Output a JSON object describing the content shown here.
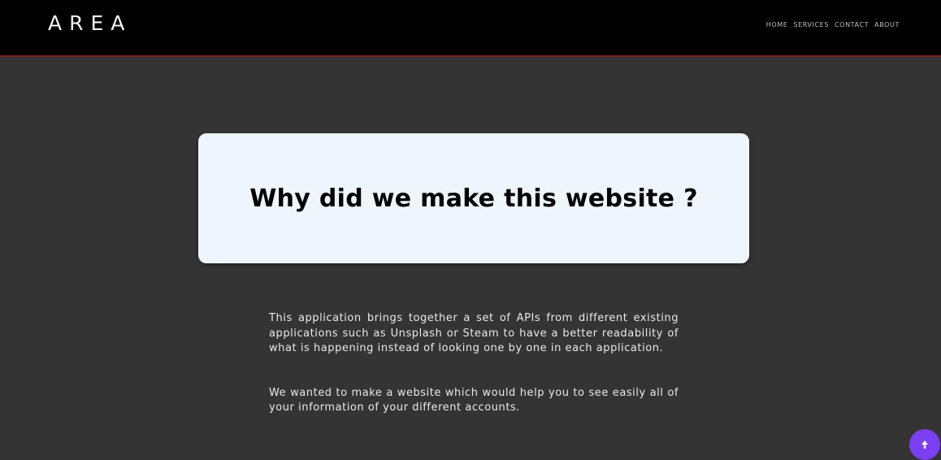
{
  "header": {
    "logo": "AREA",
    "nav": {
      "home": "HOME",
      "services": "SERVICES",
      "contact": "CONTACT",
      "about": "ABOUT"
    }
  },
  "hero": {
    "title": "Why did we make this website ?"
  },
  "content": {
    "paragraph1": "This application brings together a set of APIs from different existing applications such as Unsplash or Steam to have a better readability of what is happening instead of looking one by one in each application.",
    "paragraph2": "We wanted to make a website which would help you to see easily all of your information of your different accounts."
  },
  "scroll_top": {
    "icon": "arrow-up-icon"
  },
  "colors": {
    "background": "#343434",
    "header": "#000000",
    "header_border": "#7a1f24",
    "card": "#eef5fd",
    "accent": "#7b3ff2"
  }
}
